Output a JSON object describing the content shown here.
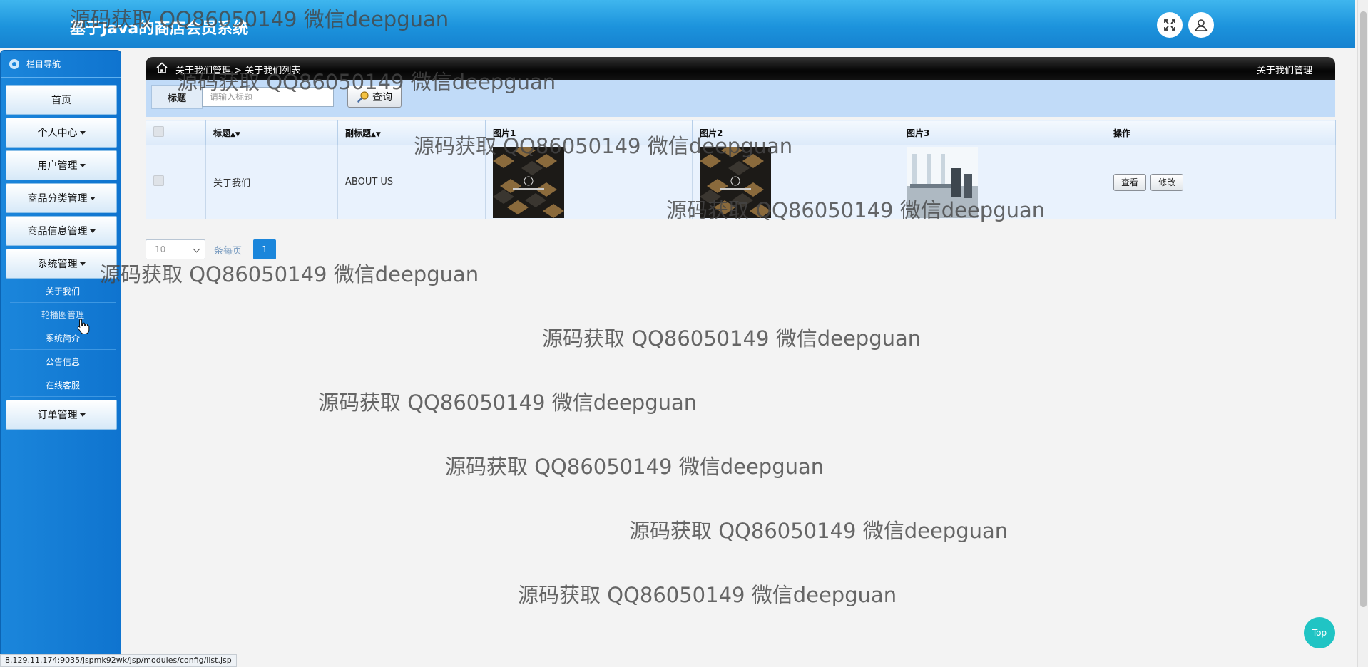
{
  "header": {
    "title": "基于Java的商店会员系统",
    "fullscreen_icon": "fullscreen-icon",
    "user_icon": "user-icon"
  },
  "sidebar": {
    "nav_title": "栏目导航",
    "items": [
      {
        "label": "首页",
        "dropdown": false
      },
      {
        "label": "个人中心",
        "dropdown": true
      },
      {
        "label": "用户管理",
        "dropdown": true
      },
      {
        "label": "商品分类管理",
        "dropdown": true
      },
      {
        "label": "商品信息管理",
        "dropdown": true
      },
      {
        "label": "系统管理",
        "dropdown": true
      },
      {
        "label": "订单管理",
        "dropdown": true
      }
    ],
    "system_submenu": [
      "关于我们",
      "轮播图管理",
      "系统简介",
      "公告信息",
      "在线客服"
    ]
  },
  "breadcrumb": {
    "parent": "关于我们管理",
    "separator": ">",
    "current": "关于我们列表",
    "right_title": "关于我们管理"
  },
  "search": {
    "label": "标题",
    "placeholder": "请输入标题",
    "button": "查询"
  },
  "table": {
    "columns": [
      "",
      "标题",
      "副标题",
      "图片1",
      "图片2",
      "图片3",
      "操作"
    ],
    "sortable": [
      "标题",
      "副标题"
    ],
    "rows": [
      {
        "title": "关于我们",
        "subtitle": "ABOUT US",
        "view": "查看",
        "edit": "修改"
      }
    ]
  },
  "pagination": {
    "page_size": "10",
    "per_page_label": "条每页",
    "current_page": "1"
  },
  "watermark_text": "源码获取 QQ86050149 微信deepguan",
  "status_url": "8.129.11.174:9035/jspmk92wk/jsp/modules/config/list.jsp",
  "top_button": "Top",
  "colors": {
    "header_blue": "#1c93dc",
    "sidebar_blue": "#1b86db",
    "search_bg": "#c1dbf8",
    "top_button": "#20c4c4"
  }
}
